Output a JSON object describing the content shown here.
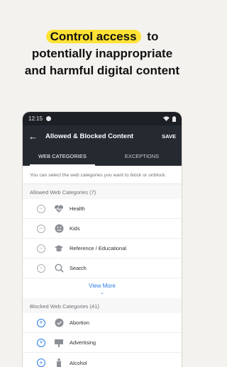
{
  "headline": {
    "highlight": "Control access",
    "line1_rest": "to",
    "line2": "potentially inappropriate",
    "line3": "and harmful digital content"
  },
  "statusbar": {
    "time": "12:15"
  },
  "appbar": {
    "title": "Allowed & Blocked Content",
    "save_label": "SAVE"
  },
  "tabs": [
    {
      "label": "WEB CATEGORIES",
      "active": true
    },
    {
      "label": "EXCEPTIONS",
      "active": false
    }
  ],
  "intro_text": "You can select the web categories you want to block or unblock.",
  "allowed": {
    "header": "Allowed Web Categories (7)",
    "items": [
      {
        "label": "Health",
        "icon": "heart-pulse-icon"
      },
      {
        "label": "Kids",
        "icon": "smiley-face-icon"
      },
      {
        "label": "Reference / Educational",
        "icon": "graduation-cap-icon"
      },
      {
        "label": "Search",
        "icon": "magnifier-icon"
      }
    ],
    "view_more": "View More"
  },
  "blocked": {
    "header": "Blocked Web Categories (41)",
    "items": [
      {
        "label": "Abortion",
        "icon": "shield-check-icon"
      },
      {
        "label": "Advertising",
        "icon": "billboard-icon"
      },
      {
        "label": "Alcohol",
        "icon": "bottle-icon"
      }
    ]
  },
  "colors": {
    "highlight": "#ffe234",
    "appbar": "#252a31",
    "link": "#2c7be5"
  }
}
